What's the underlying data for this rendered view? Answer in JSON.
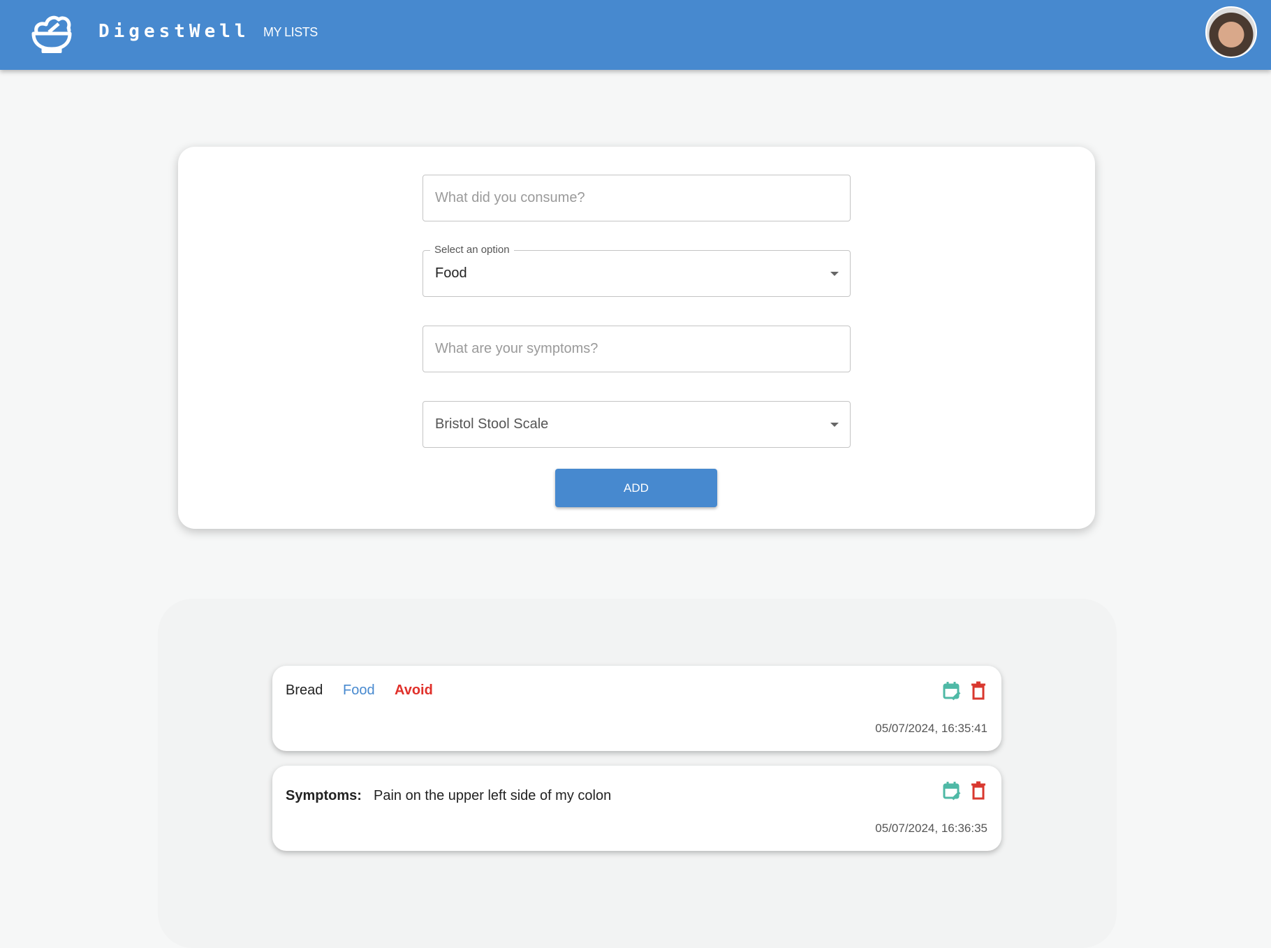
{
  "header": {
    "brand": "DigestWell",
    "nav_my_lists": "MY LISTS",
    "logo_icon": "salad-bowl-icon",
    "avatar": "user-avatar"
  },
  "form": {
    "consume_placeholder": "What did you consume?",
    "type_select": {
      "label": "Select an option",
      "value": "Food"
    },
    "symptoms_placeholder": "What are your symptoms?",
    "bristol_select": {
      "placeholder": "Bristol Stool Scale"
    },
    "add_label": "ADD"
  },
  "entries": [
    {
      "name": "Bread",
      "type": "Food",
      "verdict": "Avoid",
      "timestamp": "05/07/2024, 16:35:41"
    },
    {
      "label": "Symptoms:",
      "text": "Pain on the upper left side of my colon",
      "timestamp": "05/07/2024, 16:36:35"
    }
  ],
  "colors": {
    "primary": "#4789cf",
    "type": "#4789cf",
    "avoid": "#e0302a",
    "edit": "#4fb9a6",
    "delete": "#d9382f"
  }
}
